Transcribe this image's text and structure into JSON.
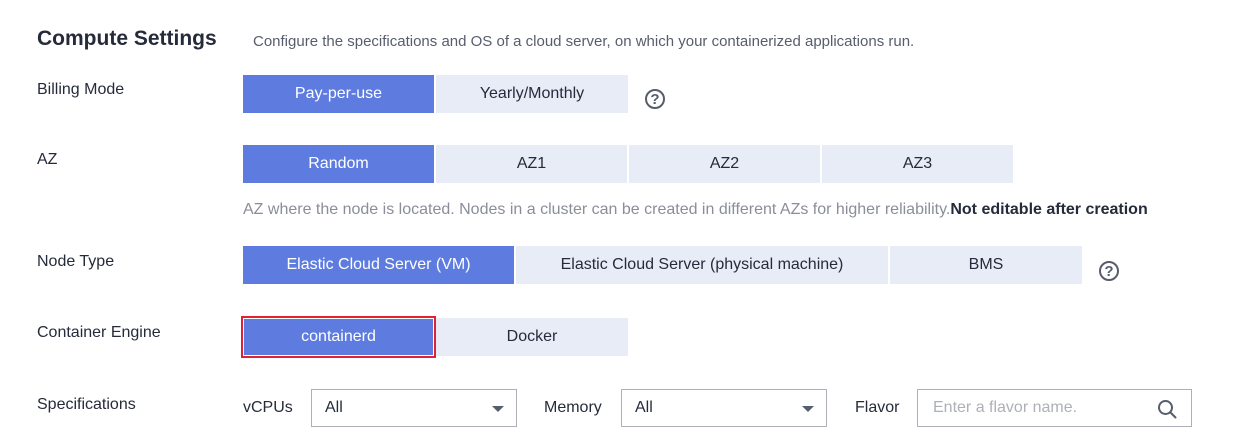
{
  "section": {
    "title": "Compute Settings",
    "description": "Configure the specifications and OS of a cloud server, on which your containerized applications run."
  },
  "billing": {
    "label": "Billing Mode",
    "options": [
      "Pay-per-use",
      "Yearly/Monthly"
    ],
    "selected": "Pay-per-use",
    "help_icon": "question-circle-icon"
  },
  "az": {
    "label": "AZ",
    "options": [
      "Random",
      "AZ1",
      "AZ2",
      "AZ3"
    ],
    "selected": "Random",
    "hint": "AZ where the node is located. Nodes in a cluster can be created in different AZs for higher reliability.",
    "hint_bold": "Not editable after creation"
  },
  "node_type": {
    "label": "Node Type",
    "options": [
      "Elastic Cloud Server (VM)",
      "Elastic Cloud Server (physical machine)",
      "BMS"
    ],
    "selected": "Elastic Cloud Server (VM)",
    "help_icon": "question-circle-icon"
  },
  "container_engine": {
    "label": "Container Engine",
    "options": [
      "containerd",
      "Docker"
    ],
    "selected": "containerd"
  },
  "specifications": {
    "label": "Specifications",
    "vcpus_label": "vCPUs",
    "vcpus_value": "All",
    "memory_label": "Memory",
    "memory_value": "All",
    "flavor_label": "Flavor",
    "flavor_placeholder": "Enter a flavor name."
  },
  "colors": {
    "accent": "#5e7ce0",
    "inactive_bg": "#e8ecf7",
    "highlight_border": "#e02233"
  }
}
